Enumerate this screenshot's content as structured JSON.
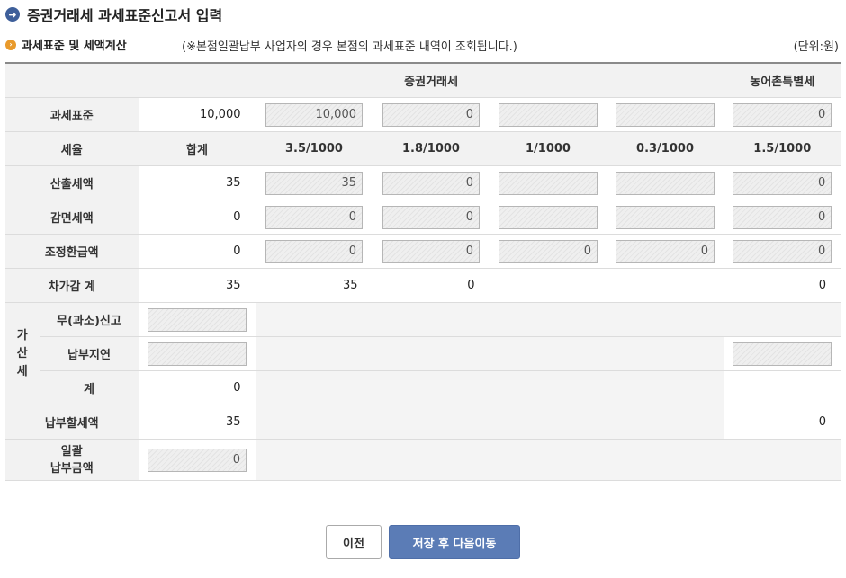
{
  "page_title": "증권거래세 과세표준신고서 입력",
  "section": {
    "title": "과세표준 및 세액계산",
    "note": "(※본점일괄납부 사업자의 경우 본점의 과세표준 내역이 조회됩니다.)",
    "unit": "(단위:원)"
  },
  "headers": {
    "securities_tax": "증권거래세",
    "rural_tax": "농어촌특별세",
    "rate_label": "세율",
    "rates": [
      "합계",
      "3.5/1000",
      "1.8/1000",
      "1/1000",
      "0.3/1000",
      "1.5/1000"
    ]
  },
  "rows": {
    "tax_base": {
      "label": "과세표준",
      "total": "10,000",
      "r35": "10,000",
      "r18": "0",
      "r10": "",
      "r03": "",
      "rural": "0"
    },
    "calc_tax": {
      "label": "산출세액",
      "total": "35",
      "r35": "35",
      "r18": "0",
      "r10": "",
      "r03": "",
      "rural": "0"
    },
    "reduction": {
      "label": "감면세액",
      "total": "0",
      "r35": "0",
      "r18": "0",
      "r10": "",
      "r03": "",
      "rural": "0"
    },
    "adjust": {
      "label": "조정환급액",
      "total": "0",
      "r35": "0",
      "r18": "0",
      "r10": "0",
      "r03": "0",
      "rural": "0"
    },
    "net_total": {
      "label": "차가감 계",
      "total": "35",
      "r35": "35",
      "r18": "0",
      "rural": "0"
    },
    "penalty": {
      "group_label": "가\n산\n세",
      "no_report": {
        "label": "무(과소)신고",
        "value": ""
      },
      "late_payment": {
        "label": "납부지연",
        "value": "",
        "rural": ""
      },
      "subtotal": {
        "label": "계",
        "value": "0"
      }
    },
    "payable": {
      "label": "납부할세액",
      "total": "35",
      "rural": "0"
    },
    "lump_sum": {
      "label": "일괄\n납부금액",
      "value": "0"
    }
  },
  "buttons": {
    "prev": "이전",
    "save_next": "저장 후 다음이동"
  }
}
